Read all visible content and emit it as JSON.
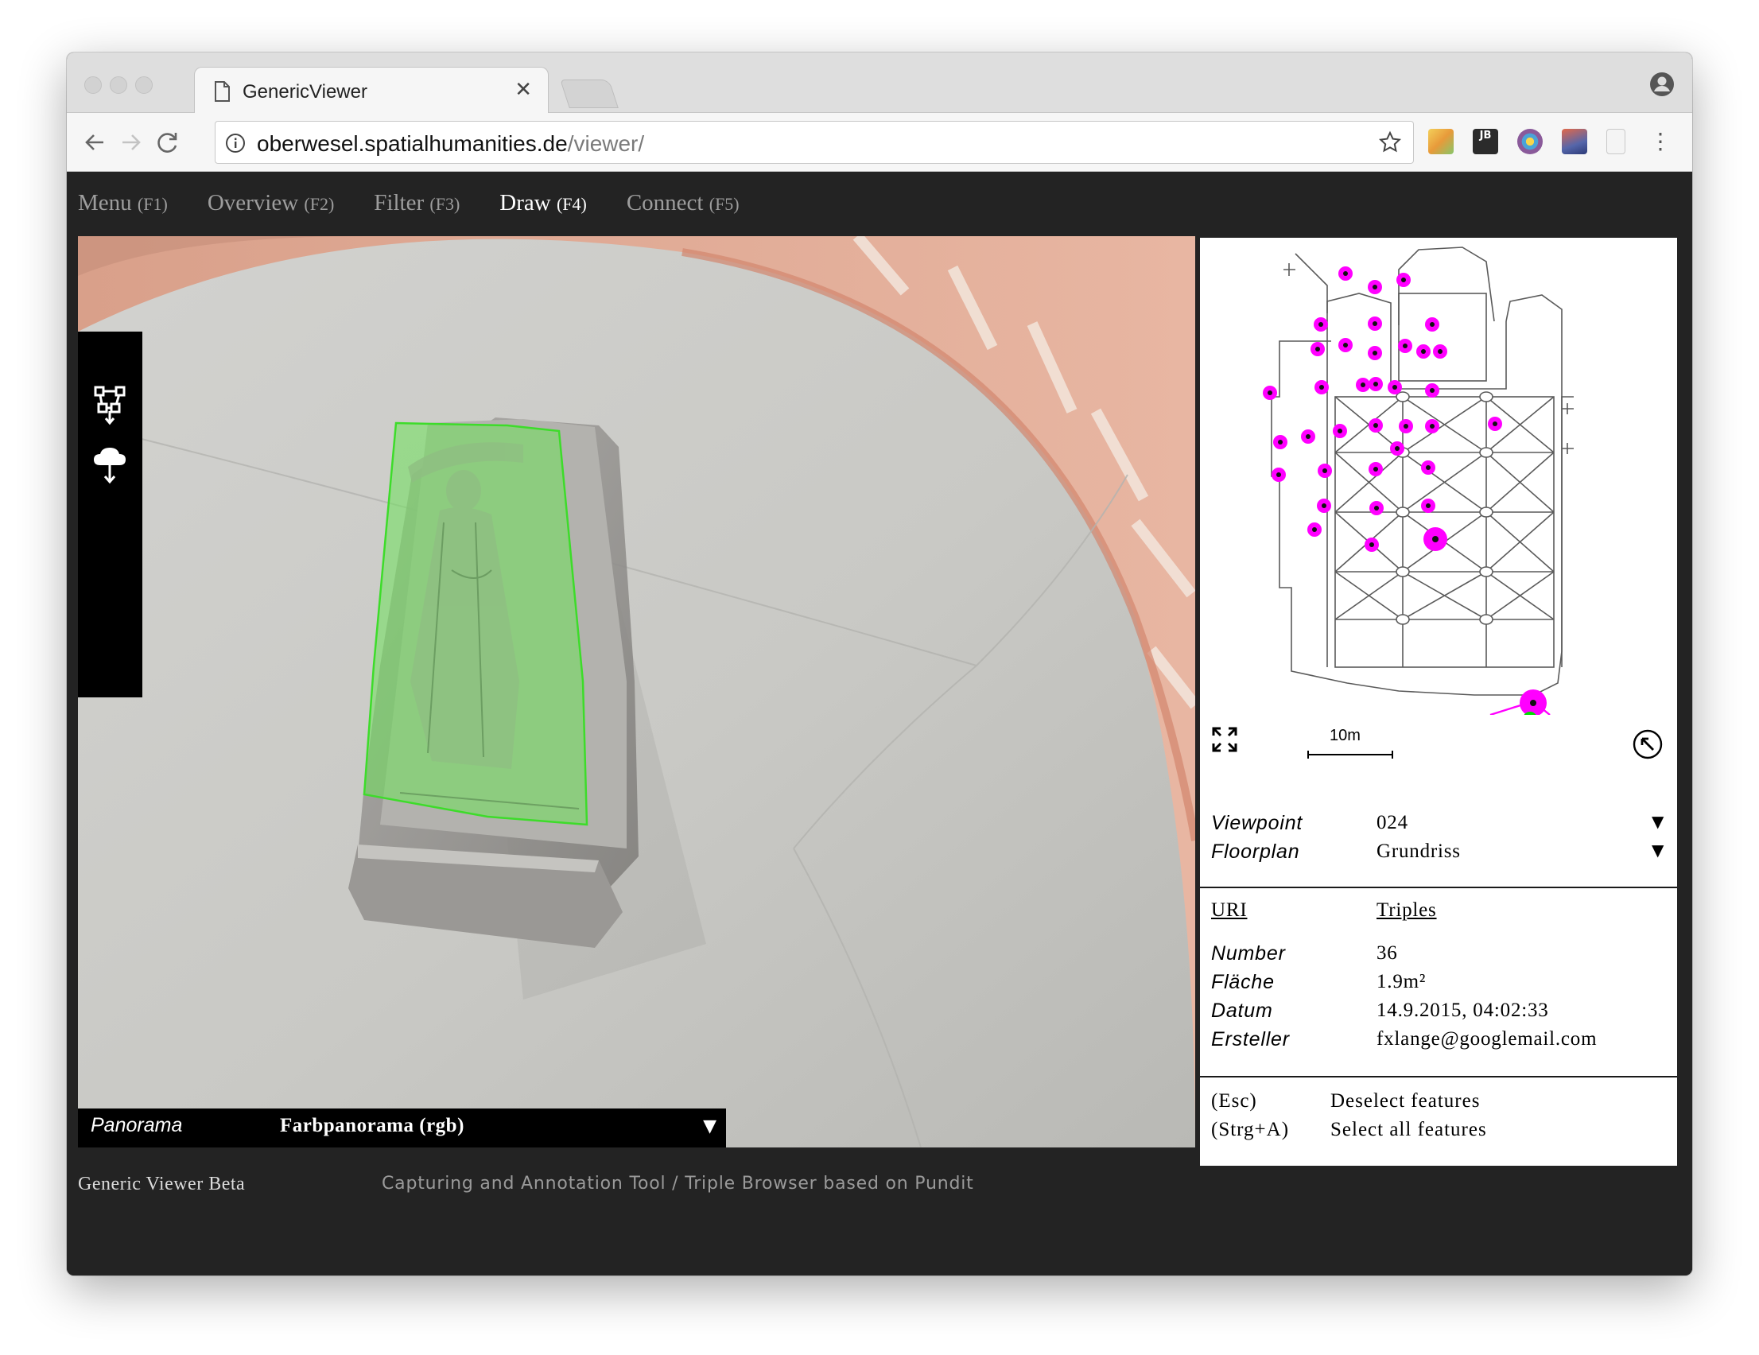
{
  "browser": {
    "tab_title": "GenericViewer",
    "url_host": "oberwesel.spatialhumanities.de",
    "url_path": "/viewer/",
    "extension_colors": [
      "#e8b84a",
      "#2b2b2b",
      "#8a5a9a",
      "#5566aa",
      "#cfcfcf"
    ]
  },
  "app": {
    "nav": [
      {
        "label": "Menu",
        "key": "(F1)"
      },
      {
        "label": "Overview",
        "key": "(F2)"
      },
      {
        "label": "Filter",
        "key": "(F3)"
      },
      {
        "label": "Draw",
        "key": "(F4)",
        "active": true
      },
      {
        "label": "Connect",
        "key": "(F5)"
      }
    ],
    "draw_tools": [
      "polygon-tool-icon",
      "upload-cloud-icon"
    ],
    "panorama": {
      "label": "Panorama",
      "value": "Farbpanorama (rgb)",
      "selection_color": "#6ee25a"
    }
  },
  "side_panel": {
    "floorplan": {
      "scale_label": "10m",
      "marker_color": "#ff00ff",
      "current_marker_color": "#00e000"
    },
    "view": [
      {
        "key": "Viewpoint",
        "value": "024"
      },
      {
        "key": "Floorplan",
        "value": "Grundriss"
      }
    ],
    "links": {
      "uri": "URI",
      "triples": "Triples"
    },
    "properties": [
      {
        "key": "Number",
        "value": "36"
      },
      {
        "key": "Fläche",
        "value": "1.9m²"
      },
      {
        "key": "Datum",
        "value": "14.9.2015, 04:02:33"
      },
      {
        "key": "Ersteller",
        "value": "fxlange@googlemail.com"
      }
    ],
    "shortcuts": [
      {
        "key": "(Esc)",
        "desc": "Deselect features"
      },
      {
        "key": "(Strg+A)",
        "desc": "Select all features"
      }
    ]
  },
  "footer": {
    "left": "Generic Viewer Beta",
    "right": "Capturing and Annotation Tool / Triple Browser based on Pundit"
  }
}
